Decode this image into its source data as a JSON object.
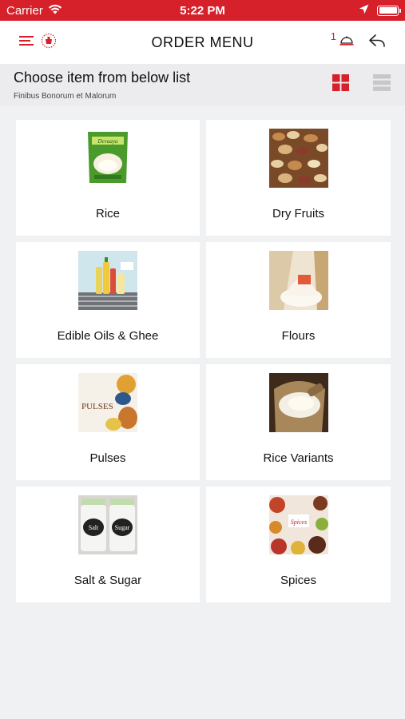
{
  "status_bar": {
    "carrier": "Carrier",
    "time": "5:22 PM"
  },
  "nav": {
    "title": "ORDER MENU",
    "cart_count": "1"
  },
  "subheader": {
    "title": "Choose item from below list",
    "caption": "Finibus Bonorum et Malorum"
  },
  "colors": {
    "accent": "#d6202a",
    "background": "#f0f1f3",
    "card": "#ffffff"
  },
  "categories": [
    {
      "label": "Rice",
      "icon": "rice-bag-image"
    },
    {
      "label": "Dry Fruits",
      "icon": "dry-fruits-image"
    },
    {
      "label": "Edible Oils & Ghee",
      "icon": "oil-bottles-image"
    },
    {
      "label": "Flours",
      "icon": "flour-image"
    },
    {
      "label": "Pulses",
      "icon": "pulses-image"
    },
    {
      "label": "Rice Variants",
      "icon": "rice-sack-image"
    },
    {
      "label": "Salt & Sugar",
      "icon": "salt-sugar-jars-image"
    },
    {
      "label": "Spices",
      "icon": "spices-image"
    }
  ],
  "pulses_image_text": "PULSES",
  "salt_jar_text": "Salt",
  "sugar_jar_text": "Sugar",
  "spices_image_text": "Spices"
}
